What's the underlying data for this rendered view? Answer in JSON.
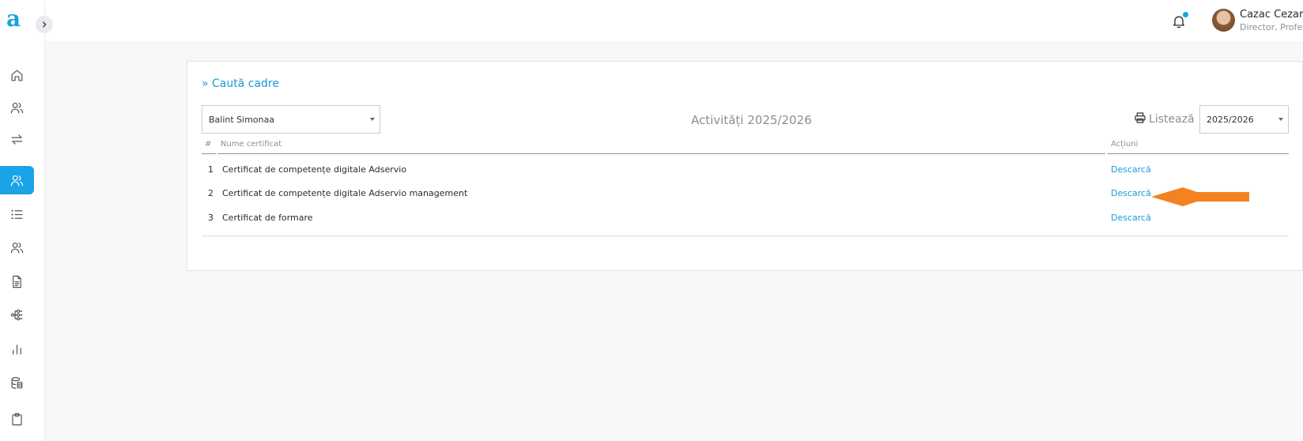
{
  "app": {
    "logo_text": "a",
    "accent_color": "#1aa3e6",
    "link_color": "#1a9ad6"
  },
  "sidebar": {
    "items": [
      {
        "icon": "home-icon"
      },
      {
        "icon": "users-icon"
      },
      {
        "icon": "transfer-icon"
      },
      {
        "icon": "staff-icon",
        "active": true
      },
      {
        "icon": "list-icon"
      },
      {
        "icon": "group-icon"
      },
      {
        "icon": "document-icon"
      },
      {
        "icon": "hierarchy-icon"
      },
      {
        "icon": "bar-chart-icon"
      },
      {
        "icon": "database-icon"
      },
      {
        "icon": "clipboard-icon"
      }
    ]
  },
  "header": {
    "user_name": "Cazac Cezara",
    "user_role": "Director, Profesor",
    "notification_dot": true
  },
  "main": {
    "search_link": "» Caută cadre",
    "teacher_select": {
      "value": "Balint Simonaa"
    },
    "activity_title": "Activități 2025/2026",
    "print_label": "Listează",
    "year_select": {
      "value": "2025/2026"
    },
    "table": {
      "headers": {
        "num": "#",
        "name": "Nume certificat",
        "actions": "Acțiuni"
      },
      "rows": [
        {
          "num": "1",
          "name": "Certificat de competențe digitale Adservio",
          "action": "Descarcă"
        },
        {
          "num": "2",
          "name": "Certificat de competențe digitale Adservio management",
          "action": "Descarcă"
        },
        {
          "num": "3",
          "name": "Certificat de formare",
          "action": "Descarcă"
        }
      ]
    },
    "annotation_arrow_color": "#f58220"
  }
}
